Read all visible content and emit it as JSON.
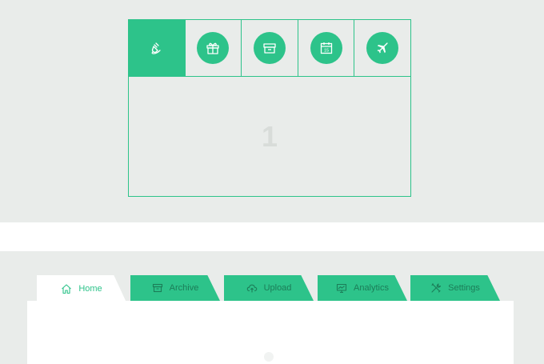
{
  "icon_tabs": {
    "items": [
      {
        "icon": "plug-icon",
        "active": true
      },
      {
        "icon": "gift-icon",
        "active": false
      },
      {
        "icon": "archive-box-icon",
        "active": false
      },
      {
        "icon": "calendar-icon",
        "calendar_day": "15",
        "active": false
      },
      {
        "icon": "airplane-icon",
        "active": false
      }
    ],
    "content_number": "1"
  },
  "folder_tabs": {
    "items": [
      {
        "label": "Home",
        "icon": "home-icon",
        "active": true
      },
      {
        "label": "Archive",
        "icon": "archive-icon",
        "active": false
      },
      {
        "label": "Upload",
        "icon": "cloud-upload-icon",
        "active": false
      },
      {
        "label": "Analytics",
        "icon": "monitor-icon",
        "active": false
      },
      {
        "label": "Settings",
        "icon": "tools-icon",
        "active": false
      }
    ]
  },
  "colors": {
    "accent": "#2dc38a",
    "background": "#e9ecea",
    "accent_dark_text": "#1c7d58"
  }
}
